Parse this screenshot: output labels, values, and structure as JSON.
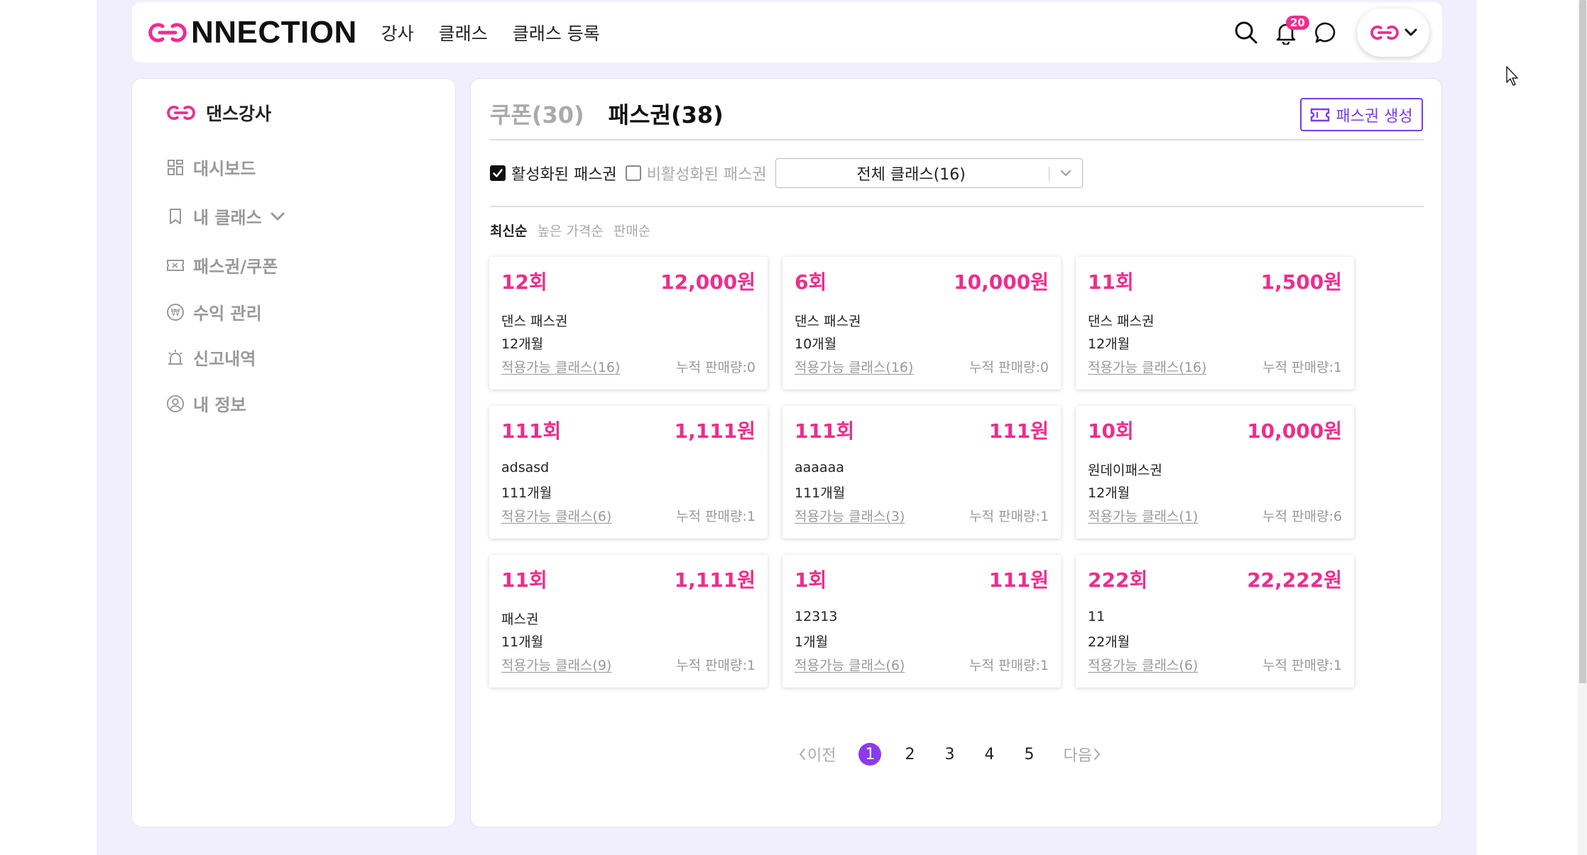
{
  "brand": {
    "logo_text": "NNECTION",
    "primary": "#ec2e8d",
    "accent": "#7c3aed"
  },
  "nav": [
    "강사",
    "클래스",
    "클래스 등록"
  ],
  "header": {
    "notification_count": "20"
  },
  "sidebar": {
    "title": "댄스강사",
    "items": [
      {
        "label": "대시보드",
        "icon": "dashboard-icon"
      },
      {
        "label": "내 클래스",
        "icon": "bookmark-icon"
      },
      {
        "label": "패스권/쿠폰",
        "icon": "ticket-icon"
      },
      {
        "label": "수익 관리",
        "icon": "won-icon"
      },
      {
        "label": "신고내역",
        "icon": "siren-icon"
      },
      {
        "label": "내 정보",
        "icon": "user-circle-icon"
      }
    ]
  },
  "main": {
    "tab_coupon": "쿠폰(30)",
    "tab_pass": "패스권(38)",
    "create_label": "패스권 생성",
    "filter_active": "활성화된 패스권",
    "filter_inactive": "비활성화된 패스권",
    "class_select": "전체 클래스(16)",
    "sort": [
      "최신순",
      "높은 가격순",
      "판매순"
    ],
    "cards": [
      {
        "count": "12회",
        "price": "12,000원",
        "name": "댄스 패스권",
        "period": "12개월",
        "classes": "적용가능 클래스(16)",
        "sales": "누적 판매량:0"
      },
      {
        "count": "6회",
        "price": "10,000원",
        "name": "댄스 패스권",
        "period": "10개월",
        "classes": "적용가능 클래스(16)",
        "sales": "누적 판매량:0"
      },
      {
        "count": "11회",
        "price": "1,500원",
        "name": "댄스 패스권",
        "period": "12개월",
        "classes": "적용가능 클래스(16)",
        "sales": "누적 판매량:1"
      },
      {
        "count": "111회",
        "price": "1,111원",
        "name": "adsasd",
        "period": "111개월",
        "classes": "적용가능 클래스(6)",
        "sales": "누적 판매량:1"
      },
      {
        "count": "111회",
        "price": "111원",
        "name": "aaaaaa",
        "period": "111개월",
        "classes": "적용가능 클래스(3)",
        "sales": "누적 판매량:1"
      },
      {
        "count": "10회",
        "price": "10,000원",
        "name": "원데이패스권",
        "period": "12개월",
        "classes": "적용가능 클래스(1)",
        "sales": "누적 판매량:6"
      },
      {
        "count": "11회",
        "price": "1,111원",
        "name": "패스권",
        "period": "11개월",
        "classes": "적용가능 클래스(9)",
        "sales": "누적 판매량:1"
      },
      {
        "count": "1회",
        "price": "111원",
        "name": "12313",
        "period": "1개월",
        "classes": "적용가능 클래스(6)",
        "sales": "누적 판매량:1"
      },
      {
        "count": "222회",
        "price": "22,222원",
        "name": "11",
        "period": "22개월",
        "classes": "적용가능 클래스(6)",
        "sales": "누적 판매량:1"
      }
    ],
    "pagination": {
      "prev": "이전",
      "next": "다음",
      "pages": [
        "1",
        "2",
        "3",
        "4",
        "5"
      ],
      "current": "1"
    }
  }
}
